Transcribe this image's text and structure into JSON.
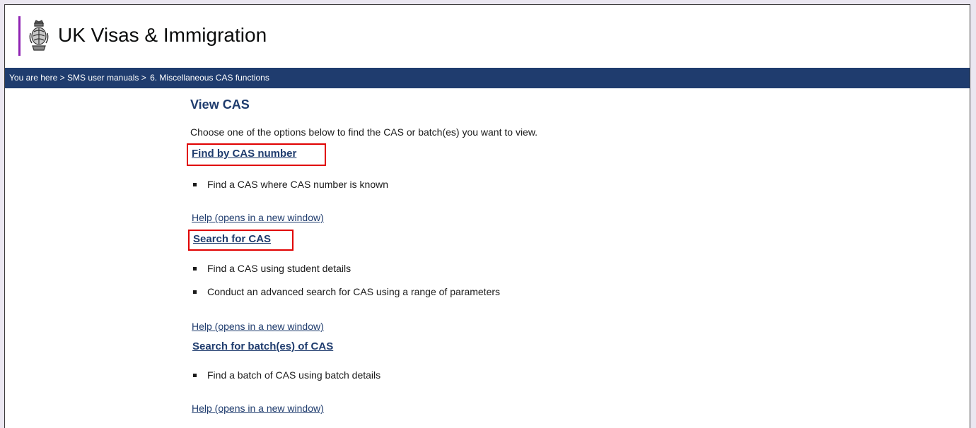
{
  "header": {
    "brand_name": "UK Visas & Immigration"
  },
  "breadcrumb": {
    "you_are_here": "You are here",
    "separator": ">",
    "items": [
      "SMS user manuals",
      "6. Miscellaneous CAS functions"
    ]
  },
  "page": {
    "title": "View CAS",
    "intro": "Choose one of the options below to find the CAS or batch(es) you want to view."
  },
  "sections": [
    {
      "link": "Find by CAS number",
      "bullets": [
        "Find a CAS where CAS number is known"
      ],
      "help": "Help (opens in a new window)"
    },
    {
      "link": "Search for CAS",
      "bullets": [
        "Find a CAS using student details",
        "Conduct an advanced search for CAS using a range of parameters"
      ],
      "help": "Help (opens in a new window)"
    },
    {
      "link": "Search for batch(es) of CAS",
      "bullets": [
        "Find a batch of CAS using batch details"
      ],
      "help": "Help (opens in a new window)"
    }
  ],
  "colors": {
    "brand_purple": "#8f23b3",
    "nav_blue": "#1f3c6e",
    "highlight_red": "#e00000"
  }
}
